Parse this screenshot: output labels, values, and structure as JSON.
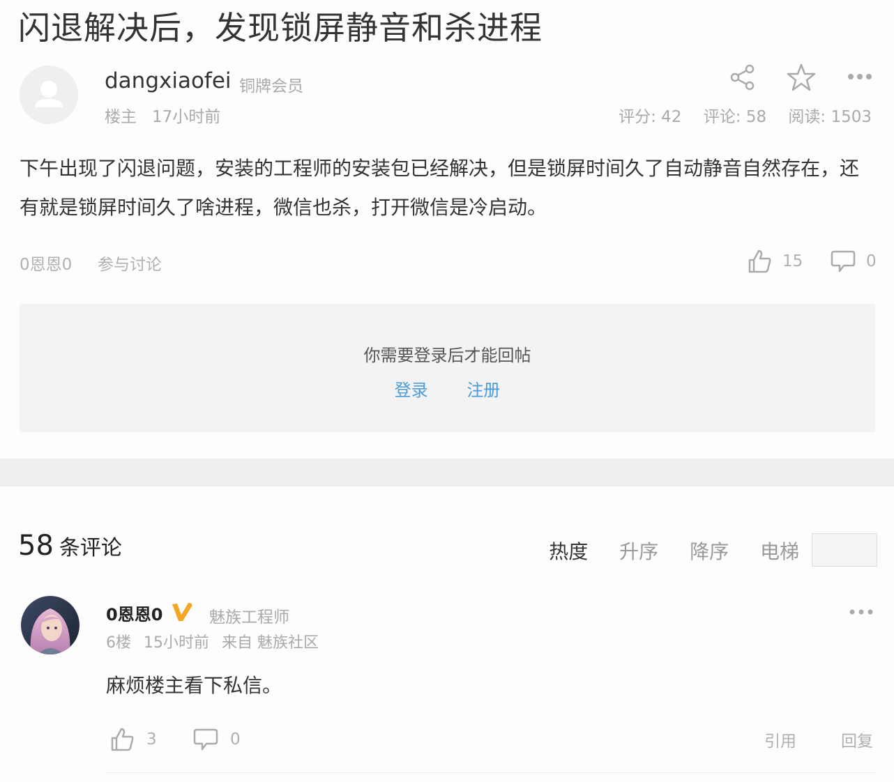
{
  "post": {
    "title": "闪退解决后，发现锁屏静音和杀进程",
    "author": "dangxiaofei",
    "member_level": "铜牌会员",
    "role": "楼主",
    "time": "17小时前",
    "score": "评分: 42",
    "comments": "评论: 58",
    "reads": "阅读: 1503",
    "body": "下午出现了闪退问题，安装的工程师的安装包已经解决，但是锁屏时间久了自动静音自然存在，还有就是锁屏时间久了啥进程，微信也杀，打开微信是冷启动。",
    "tag_user": "0恩恩0",
    "tag_discuss": "参与讨论",
    "likes": "15",
    "replies": "0"
  },
  "login": {
    "tip": "你需要登录后才能回帖",
    "login_label": "登录",
    "register_label": "注册"
  },
  "comments_header": {
    "count": "58",
    "count_label": "条评论",
    "sorts": [
      "热度",
      "升序",
      "降序",
      "电梯"
    ]
  },
  "comment": {
    "name": "0恩恩0",
    "role": "魅族工程师",
    "floor": "6楼",
    "time": "15小时前",
    "source": "来自 魅族社区",
    "body": "麻烦楼主看下私信。",
    "likes": "3",
    "replies": "0",
    "quote_label": "引用",
    "reply_label": "回复"
  },
  "icons": [
    "user-placeholder-icon",
    "share-icon",
    "star-icon",
    "more-icon",
    "thumbs-up-icon",
    "comment-bubble-icon",
    "verified-v-icon"
  ],
  "colors": {
    "link": "#4a9bd9",
    "verified": "#f5a623",
    "muted": "#aaaaaa"
  }
}
